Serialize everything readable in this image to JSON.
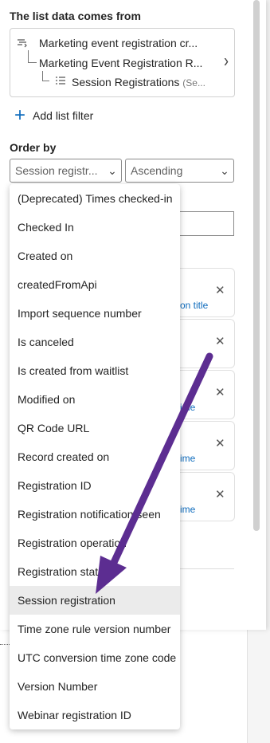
{
  "source": {
    "title": "The list data comes from",
    "rows": [
      {
        "label": "Marketing event registration cr..."
      },
      {
        "label": "Marketing Event Registration R..."
      },
      {
        "label": "Session Registrations",
        "suffix": "(Se..."
      }
    ]
  },
  "add_filter": {
    "label": "Add list filter"
  },
  "order_by": {
    "title": "Order by",
    "field_value": "Session registr...",
    "direction_value": "Ascending"
  },
  "background": {
    "card_links": [
      "on title",
      "ime",
      "ime",
      "ime"
    ]
  },
  "menu": {
    "items": [
      "(Deprecated) Times checked-in",
      "Checked In",
      "Created on",
      "createdFromApi",
      "Import sequence number",
      "Is canceled",
      "Is created from waitlist",
      "Modified on",
      "QR Code URL",
      "Record created on",
      "Registration ID",
      "Registration notification seen",
      "Registration operation",
      "Registration status",
      "Session registration",
      "Time zone rule version number",
      "UTC conversion time zone code",
      "Version Number",
      "Webinar registration ID"
    ],
    "selected_index": 14
  },
  "colors": {
    "accent": "#0f6cbd",
    "annotation_arrow": "#5c2d91",
    "selected_bg": "#ebebeb"
  }
}
